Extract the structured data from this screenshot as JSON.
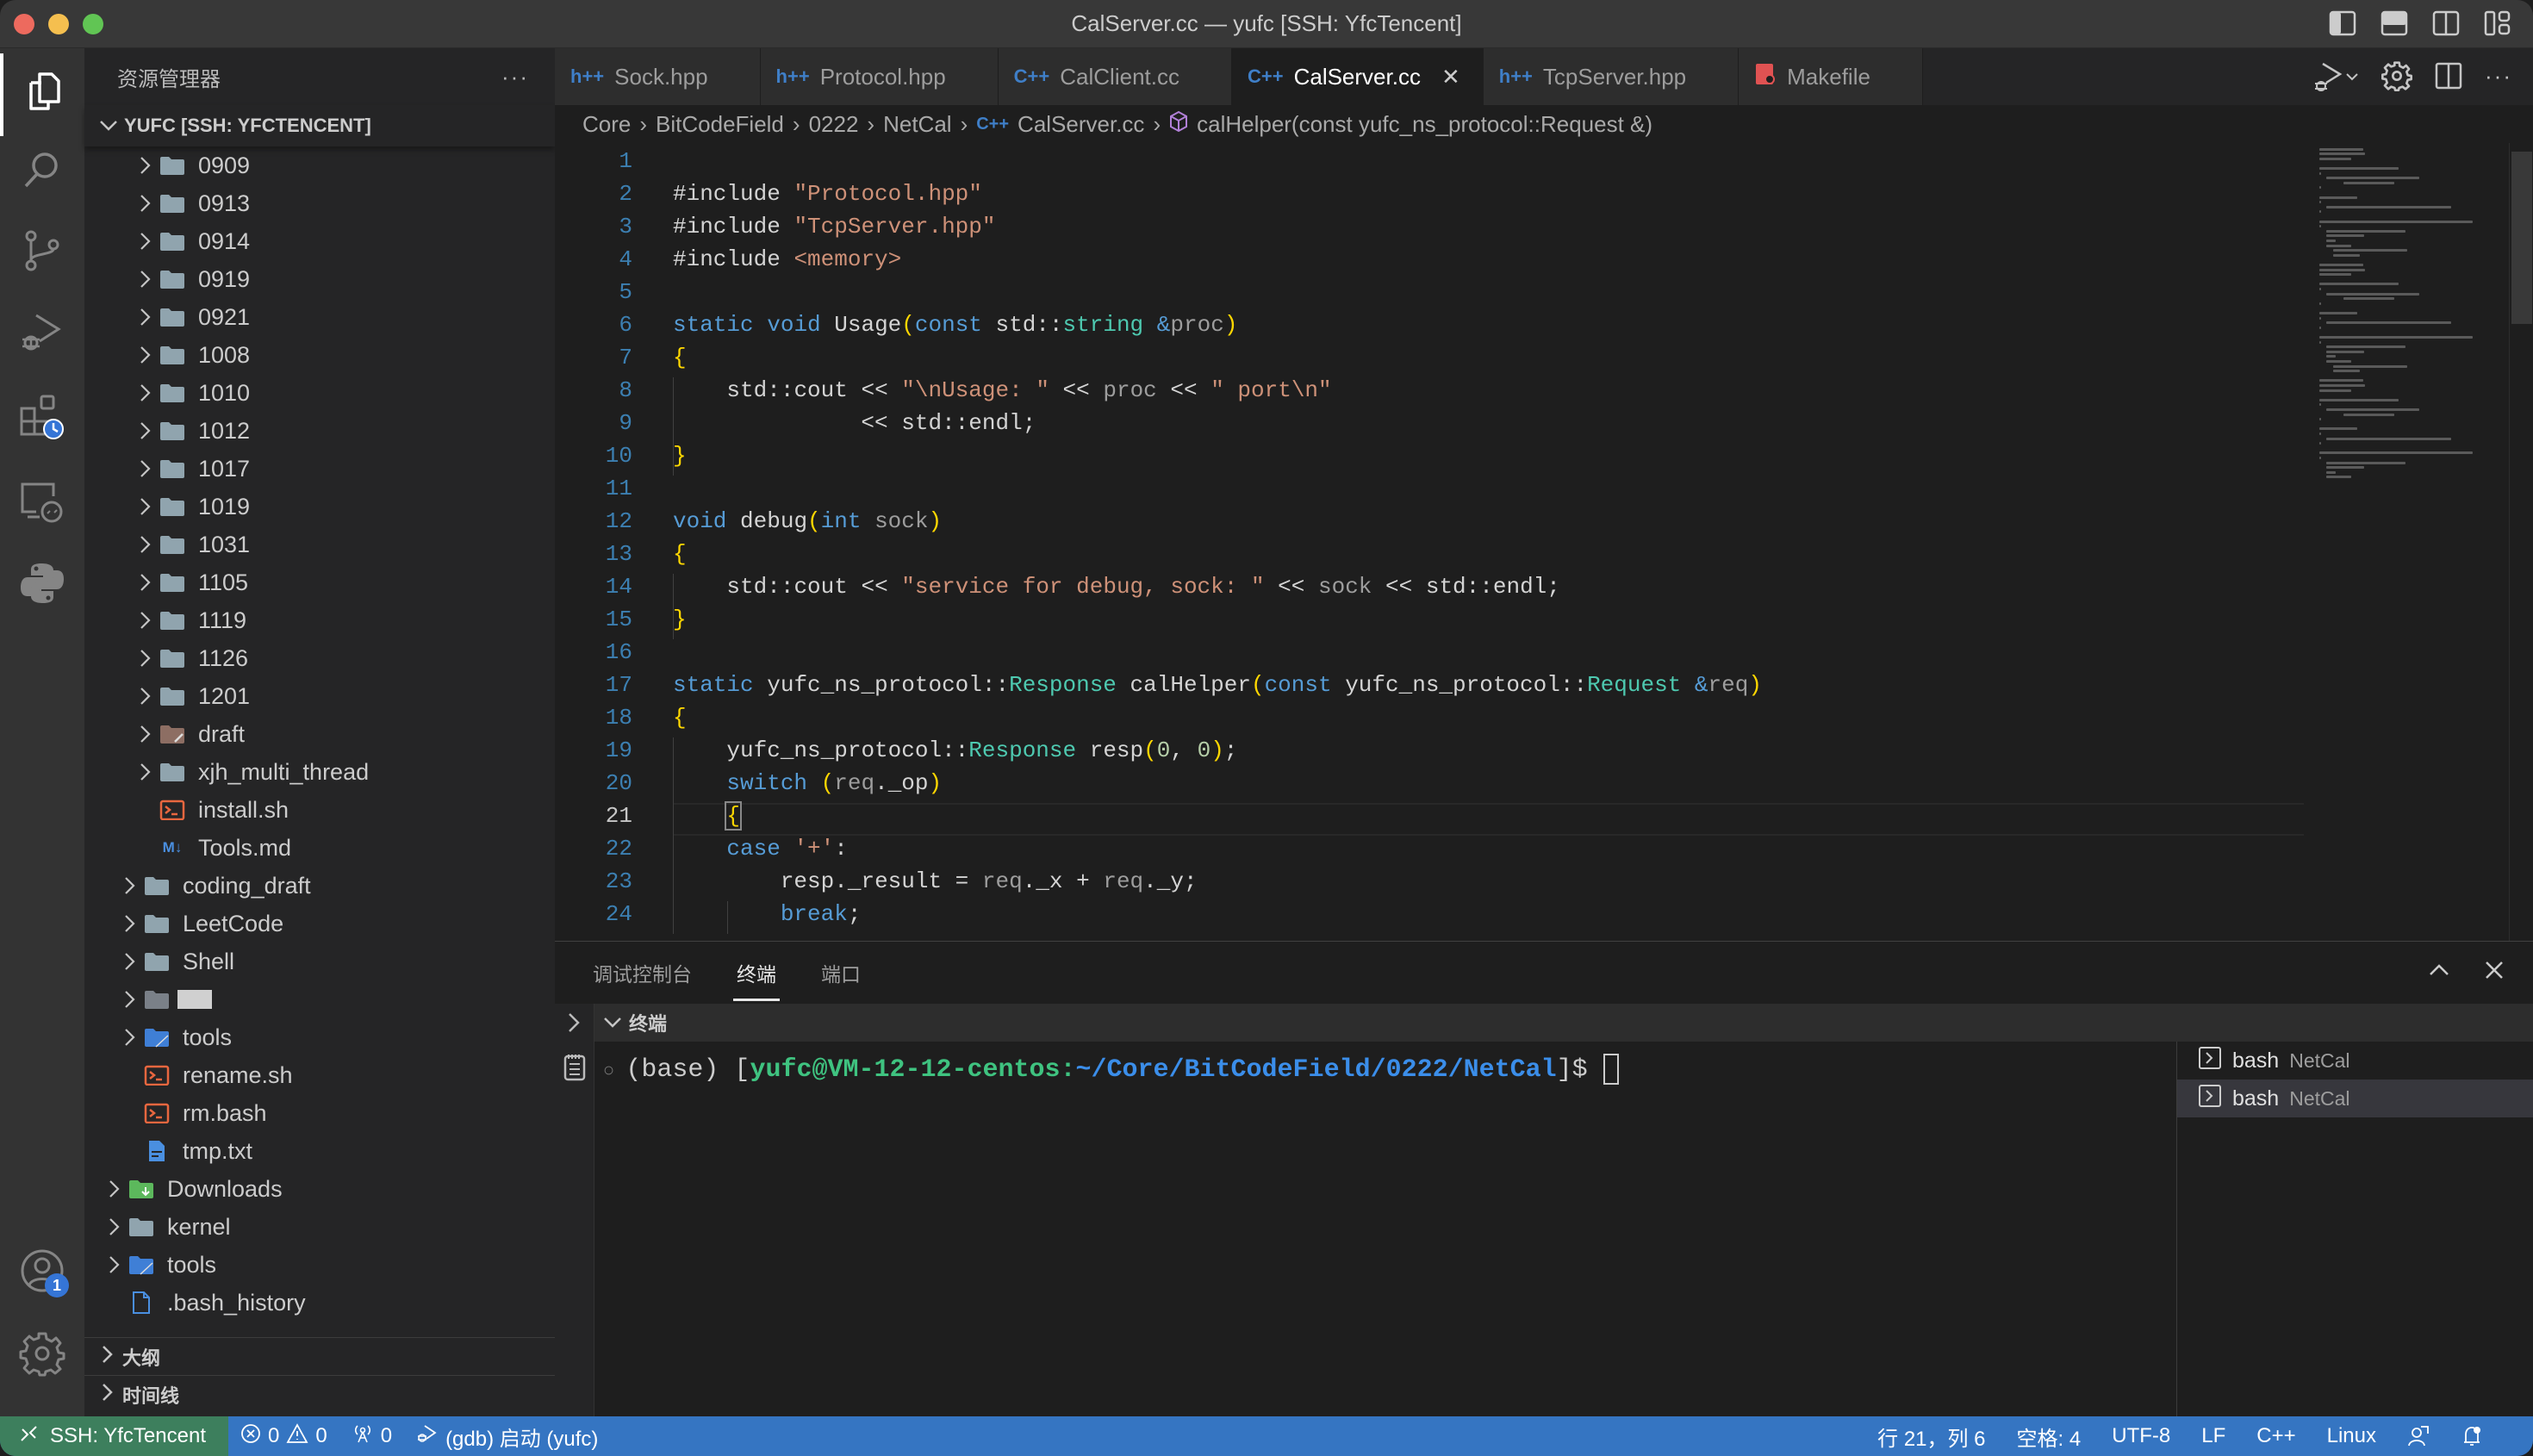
{
  "window": {
    "title": "CalServer.cc — yufc [SSH: YfcTencent]"
  },
  "activity_bar": {
    "accounts_badge": "1"
  },
  "sidebar": {
    "header": "资源管理器",
    "more": "···",
    "root": "YUFC [SSH: YFCTENCENT]",
    "items": [
      {
        "label": "0909",
        "type": "folder",
        "depth": 2
      },
      {
        "label": "0913",
        "type": "folder",
        "depth": 2
      },
      {
        "label": "0914",
        "type": "folder",
        "depth": 2
      },
      {
        "label": "0919",
        "type": "folder",
        "depth": 2
      },
      {
        "label": "0921",
        "type": "folder",
        "depth": 2
      },
      {
        "label": "1008",
        "type": "folder",
        "depth": 2
      },
      {
        "label": "1010",
        "type": "folder",
        "depth": 2
      },
      {
        "label": "1012",
        "type": "folder",
        "depth": 2
      },
      {
        "label": "1017",
        "type": "folder",
        "depth": 2
      },
      {
        "label": "1019",
        "type": "folder",
        "depth": 2
      },
      {
        "label": "1031",
        "type": "folder",
        "depth": 2
      },
      {
        "label": "1105",
        "type": "folder",
        "depth": 2
      },
      {
        "label": "1119",
        "type": "folder",
        "depth": 2
      },
      {
        "label": "1126",
        "type": "folder",
        "depth": 2
      },
      {
        "label": "1201",
        "type": "folder",
        "depth": 2
      },
      {
        "label": "draft",
        "type": "folder-draft",
        "depth": 2
      },
      {
        "label": "xjh_multi_thread",
        "type": "folder",
        "depth": 2
      },
      {
        "label": "install.sh",
        "type": "shell",
        "depth": 2
      },
      {
        "label": "Tools.md",
        "type": "markdown",
        "depth": 2
      },
      {
        "label": "coding_draft",
        "type": "folder",
        "depth": 1
      },
      {
        "label": "LeetCode",
        "type": "folder",
        "depth": 1
      },
      {
        "label": "Shell",
        "type": "folder",
        "depth": 1
      },
      {
        "label": "",
        "type": "folder-redacted",
        "depth": 1
      },
      {
        "label": "tools",
        "type": "folder-tools",
        "depth": 1
      },
      {
        "label": "rename.sh",
        "type": "shell",
        "depth": 1
      },
      {
        "label": "rm.bash",
        "type": "shell",
        "depth": 1
      },
      {
        "label": "tmp.txt",
        "type": "text",
        "depth": 1
      },
      {
        "label": "Downloads",
        "type": "folder-download",
        "depth": 0
      },
      {
        "label": "kernel",
        "type": "folder",
        "depth": 0
      },
      {
        "label": "tools",
        "type": "folder-tools",
        "depth": 0
      },
      {
        "label": ".bash_history",
        "type": "file",
        "depth": 0
      }
    ],
    "sections": [
      "大纲",
      "时间线"
    ]
  },
  "tabs": [
    {
      "label": "Sock.hpp",
      "icon": "h++",
      "active": false
    },
    {
      "label": "Protocol.hpp",
      "icon": "h++",
      "active": false
    },
    {
      "label": "CalClient.cc",
      "icon": "C++",
      "active": false
    },
    {
      "label": "CalServer.cc",
      "icon": "C++",
      "active": true
    },
    {
      "label": "TcpServer.hpp",
      "icon": "h++",
      "active": false
    },
    {
      "label": "Makefile",
      "icon": "makefile",
      "active": false
    }
  ],
  "breadcrumb": [
    "Core",
    "BitCodeField",
    "0222",
    "NetCal",
    "CalServer.cc",
    "calHelper(const yufc_ns_protocol::Request &)"
  ],
  "code": {
    "current_line": 21,
    "lines": [
      "",
      "#include \"Protocol.hpp\"",
      "#include \"TcpServer.hpp\"",
      "#include <memory>",
      "",
      "static void Usage(const std::string &proc)",
      "{",
      "    std::cout << \"\\nUsage: \" << proc << \" port\\n\"",
      "              << std::endl;",
      "}",
      "",
      "void debug(int sock)",
      "{",
      "    std::cout << \"service for debug, sock: \" << sock << std::endl;",
      "}",
      "",
      "static yufc_ns_protocol::Response calHelper(const yufc_ns_protocol::Request &req)",
      "{",
      "    yufc_ns_protocol::Response resp(0, 0);",
      "    switch (req._op)",
      "    {",
      "    case '+':",
      "        resp._result = req._x + req._y;",
      "        break;"
    ]
  },
  "panel": {
    "tabs": [
      "调试控制台",
      "终端",
      "端口"
    ],
    "active_tab": "终端",
    "terminal_header": "终端",
    "prompt": {
      "prefix": "(base) [",
      "user_host": "yufc@VM-12-12-centos",
      "colon": ":",
      "path": "~/Core/BitCodeField/0222/NetCal",
      "suffix": "]$ "
    },
    "terminals": [
      {
        "name": "bash",
        "cwd": "NetCal",
        "selected": false
      },
      {
        "name": "bash",
        "cwd": "NetCal",
        "selected": true
      }
    ]
  },
  "statusbar": {
    "remote": "SSH: YfcTencent",
    "errors": "0",
    "warnings": "0",
    "ports": "0",
    "debug": "(gdb) 启动 (yufc)",
    "cursor": "行 21，列 6",
    "indent": "空格: 4",
    "encoding": "UTF-8",
    "eol": "LF",
    "language": "C++",
    "os": "Linux"
  },
  "colors": {
    "accent": "#3575c2",
    "remote": "#3d7f5d",
    "keyword": "#569cd6",
    "string": "#ce9178",
    "type": "#4ec9b0"
  }
}
